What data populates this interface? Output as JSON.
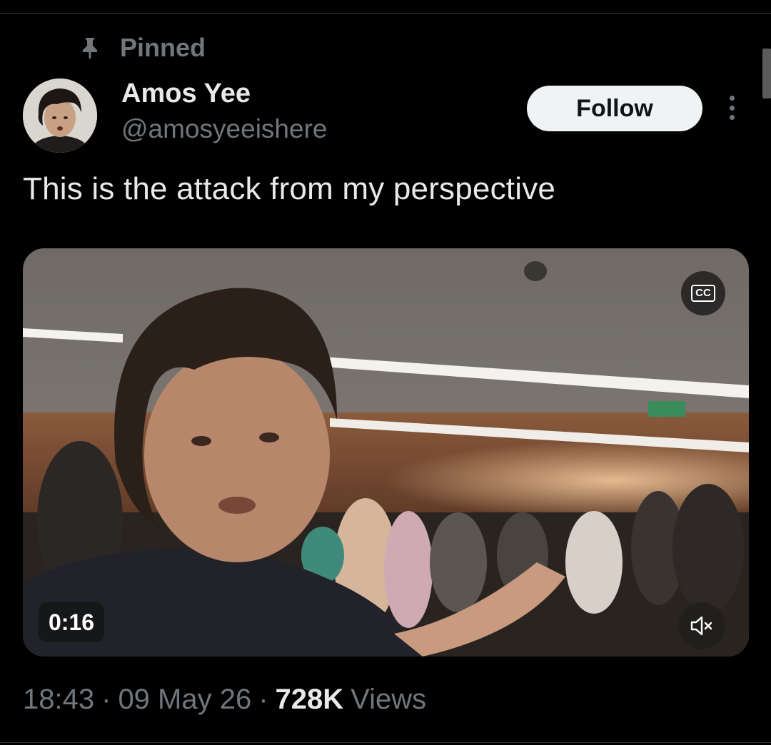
{
  "pinned": {
    "label": "Pinned"
  },
  "author": {
    "name": "Amos Yee",
    "handle": "@amosyeeishere"
  },
  "actions": {
    "follow_label": "Follow"
  },
  "tweet": {
    "text": "This is the attack from my perspective"
  },
  "video": {
    "duration": "0:16",
    "captions_label": "CC",
    "muted": true
  },
  "meta": {
    "time": "18:43",
    "separator": "·",
    "date": "09 May 26",
    "views_count": "728K",
    "views_label": "Views"
  },
  "icons": [
    "pin-icon",
    "avatar",
    "more-icon",
    "captions-icon",
    "mute-icon"
  ],
  "colors": {
    "background": "#000000",
    "text": "#e7e9ea",
    "secondary": "#71767b",
    "follow_bg": "#eff3f4"
  }
}
